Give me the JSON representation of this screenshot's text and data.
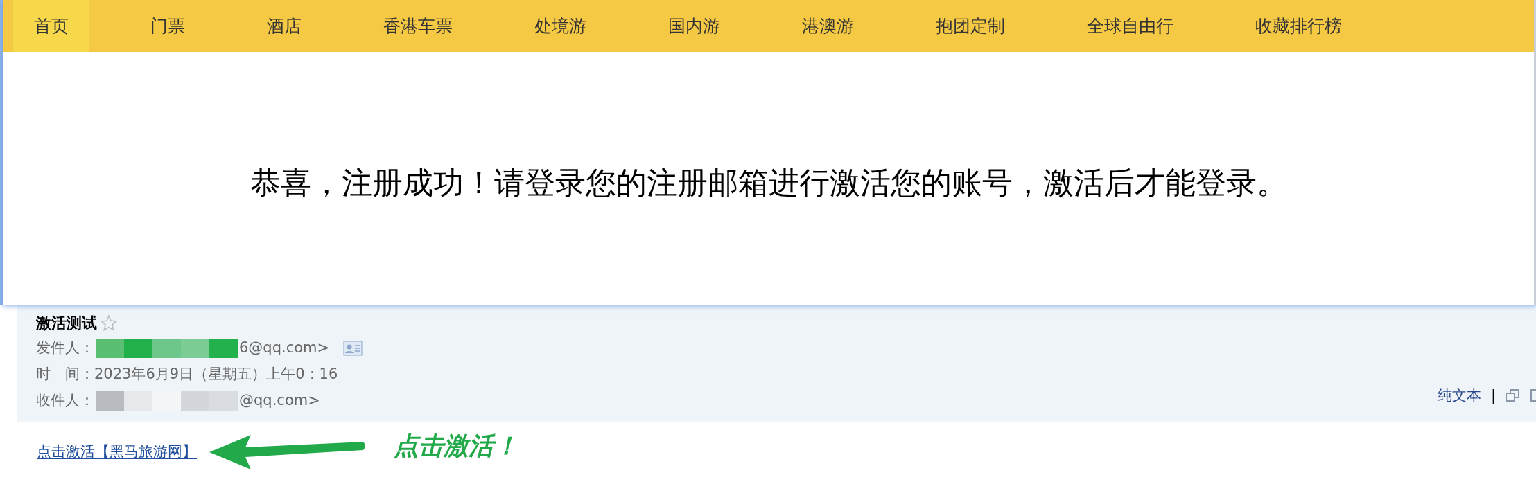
{
  "nav": {
    "items": [
      {
        "label": "首页",
        "selected": true
      },
      {
        "label": "门票",
        "selected": false
      },
      {
        "label": "酒店",
        "selected": false
      },
      {
        "label": "香港车票",
        "selected": false
      },
      {
        "label": "处境游",
        "selected": false
      },
      {
        "label": "国内游",
        "selected": false
      },
      {
        "label": "港澳游",
        "selected": false
      },
      {
        "label": "抱团定制",
        "selected": false
      },
      {
        "label": "全球自由行",
        "selected": false
      },
      {
        "label": "收藏排行榜",
        "selected": false
      }
    ]
  },
  "notice": "恭喜，注册成功！请登录您的注册邮箱进行激活您的账号，激活后才能登录。",
  "email": {
    "subject": "激活测试",
    "starred": false,
    "fields": [
      {
        "kind": "sender",
        "label": "发件人：",
        "value": "6@qq.com>"
      },
      {
        "kind": "plain",
        "label": "时　间：",
        "value": "2023年6月9日（星期五）上午0：16"
      },
      {
        "kind": "recipient",
        "label": "收件人：",
        "value": "@qq.com>"
      }
    ],
    "view_link": "纯文本",
    "separator": "|"
  },
  "body": {
    "link": "点击激活【黑马旅游网】",
    "annotation": "点击激活！"
  }
}
